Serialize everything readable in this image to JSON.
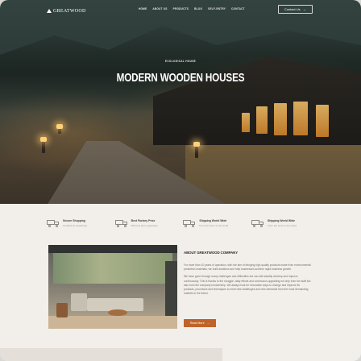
{
  "nav": {
    "logo_text": "GREATWOOD",
    "menu": [
      "Home",
      "About Us",
      "Products",
      "Blog",
      "Self-Entry",
      "Contact"
    ],
    "contact_button": "Contact Us",
    "contact_arrow": "→"
  },
  "hero": {
    "eyebrow": "ECOLOGICAL HOUSE",
    "title": "MODERN WOODEN HOUSES"
  },
  "features": [
    {
      "title": "Secure Shopping",
      "subtitle": "Certified by Guarantee",
      "icon": "truck-icon"
    },
    {
      "title": "Best Factory Price",
      "subtitle": "With low price guarantee",
      "icon": "truck-icon"
    },
    {
      "title": "Shipping World Wide",
      "subtitle": "From the store to the world",
      "icon": "truck-icon"
    },
    {
      "title": "Shipping World Wide",
      "subtitle": "From the store to the world",
      "icon": "truck-icon"
    }
  ],
  "about": {
    "title": "ABOUT GREATWOOD COMPANY",
    "paragraph1": "For more than 10 years of operation, with the aim of bringing high quality products made from environmental protection materials, we build solutions and help businesses achieve rapid business growth.",
    "paragraph2": "We have gone through many challenges and difficulties but can still steadily develop and improve continuously. This is thanks to the struggle, daily efforts and continuous upgrading not only from the staff but also from the company's leadership. We always look for innovative ways to change and improve its products, processes and techniques to meet new challenges and new demands from the most demanding markets in the future.",
    "button_label": "Read More",
    "button_arrow": "→"
  },
  "colors": {
    "accent": "#c0632a",
    "background": "#f2efeb"
  }
}
